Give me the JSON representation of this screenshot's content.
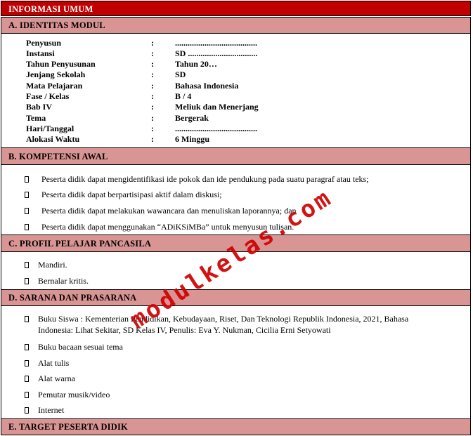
{
  "header_title": "INFORMASI UMUM",
  "sections": {
    "a_title": "A. IDENTITAS MODUL",
    "b_title": "B. KOMPETENSI AWAL",
    "c_title": "C. PROFIL PELAJAR PANCASILA",
    "d_title": "D. SARANA DAN PRASARANA",
    "e_title": "E. TARGET PESERTA DIDIK"
  },
  "identity": [
    {
      "key": "Penyusun",
      "sep": ":",
      "value": "......................................."
    },
    {
      "key": "Instansi",
      "sep": ":",
      "value": "SD ................................."
    },
    {
      "key": "Tahun Penyusunan",
      "sep": ":",
      "value": "Tahun 20…"
    },
    {
      "key": "Jenjang Sekolah",
      "sep": ":",
      "value": "SD"
    },
    {
      "key": "Mata Pelajaran",
      "sep": ":",
      "value": "Bahasa Indonesia"
    },
    {
      "key": "Fase / Kelas",
      "sep": ":",
      "value": "B / 4"
    },
    {
      "key": "Bab IV",
      "sep": ":",
      "value": "Meliuk dan Menerjang"
    },
    {
      "key": "Tema",
      "sep": ":",
      "value": "Bergerak"
    },
    {
      "key": "Hari/Tanggal",
      "sep": ":",
      "value": "......................................."
    },
    {
      "key": "Alokasi Waktu",
      "sep": ":",
      "value": "6 Minggu"
    }
  ],
  "kompetensi": [
    "Peserta didik dapat mengidentifikasi ide pokok dan ide pendukung pada suatu paragraf atau teks;",
    "Peserta didik dapat berpartisipasi aktif dalam diskusi;",
    "Peserta didik dapat melakukan wawancara dan menuliskan laporannya; dan",
    "Peserta didik dapat menggunakan “ADiKSiMBa” untuk menyusun tulisan."
  ],
  "profil": [
    "Mandiri.",
    "Bernalar kritis."
  ],
  "sarana": {
    "buku_siswa_line1": "Buku Siswa : Kementerian Pendidikan, Kebudayaan, Riset, Dan Teknologi Republik Indonesia, 2021, Bahasa",
    "buku_siswa_line2": "Indonesia: Lihat Sekitar, SD Kelas IV, Penulis: Eva Y. Nukman, Cicilia Erni Setyowati",
    "items": [
      "Buku bacaan sesuai tema",
      "Alat tulis",
      "Alat warna",
      "Pemutar musik/video",
      "Internet"
    ]
  },
  "watermark": "modulkelas.com",
  "colors": {
    "header_bg": "#c00000",
    "section_bg": "#d99594",
    "watermark": "#d00000"
  }
}
